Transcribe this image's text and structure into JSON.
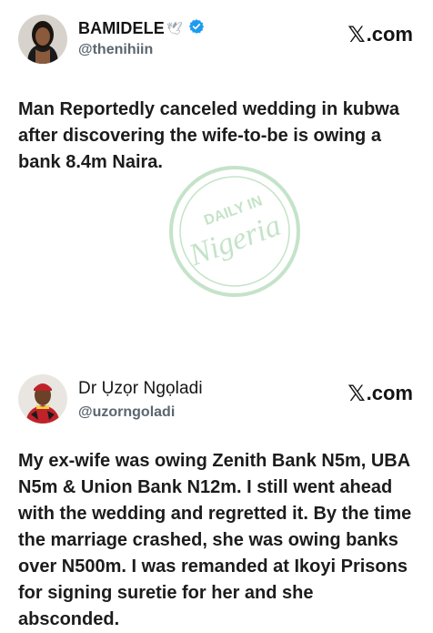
{
  "post1": {
    "name": "BAMIDELE",
    "dove_emoji": "🕊",
    "handle": "@thenihiin",
    "brand": ".com",
    "text": "Man Reportedly canceled wedding in kubwa after discovering the wife-to-be is owing a bank 8.4m Naira."
  },
  "post2": {
    "name": "Dr Ụzọr Ngọladi",
    "handle": "@uzorngoladi",
    "brand": ".com",
    "text": "My ex-wife was owing Zenith Bank N5m, UBA N5m & Union Bank N12m. I still went ahead with the wedding and regretted it. By the time the marriage crashed, she was owing banks over N500m. I was remanded at Ikoyi Prisons for signing suretie for her and she absconded."
  },
  "watermark": {
    "text_top": "DAILY IN",
    "text_main": "Nigeria"
  },
  "colors": {
    "verified": "#1d9bf0",
    "watermark": "#2e9e3e",
    "handle": "#5b6670"
  }
}
